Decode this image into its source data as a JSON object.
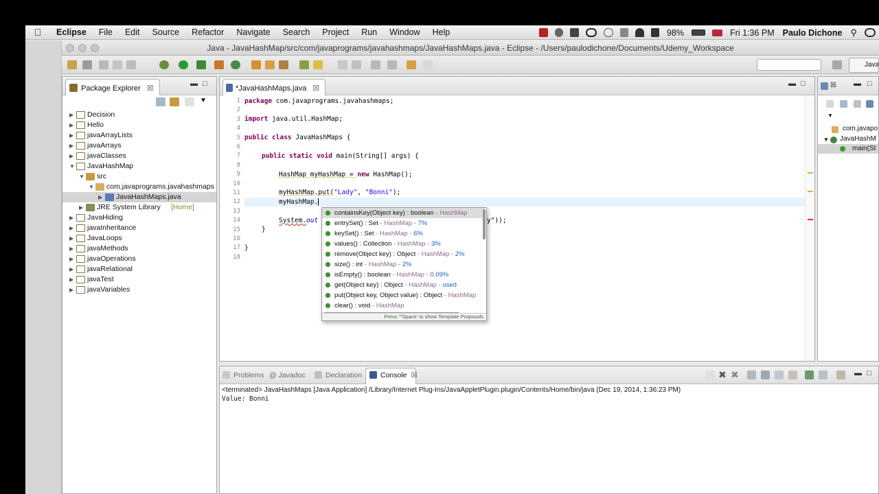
{
  "menubar": {
    "app_name": "Eclipse",
    "items": [
      "File",
      "Edit",
      "Source",
      "Refactor",
      "Navigate",
      "Search",
      "Project",
      "Run",
      "Window",
      "Help"
    ],
    "battery": "98%",
    "clock": "Fri 1:36 PM",
    "user": "Paulo Dichone"
  },
  "window": {
    "title": "Java - JavaHashMap/src/com/javaprograms/javahashmaps/JavaHashMaps.java - Eclipse - /Users/paulodichone/Documents/Udemy_Workspace"
  },
  "toolbar": {
    "perspective_label": "Java"
  },
  "package_explorer": {
    "tab_label": "Package Explorer",
    "close_glyph": "☒",
    "tree": [
      {
        "label": "Decision",
        "level": 0,
        "expanded": false,
        "kind": "project"
      },
      {
        "label": "Hello",
        "level": 0,
        "expanded": false,
        "kind": "project"
      },
      {
        "label": "javaArrayLists",
        "level": 0,
        "expanded": false,
        "kind": "project"
      },
      {
        "label": "javaArrays",
        "level": 0,
        "expanded": false,
        "kind": "project"
      },
      {
        "label": "javaClasses",
        "level": 0,
        "expanded": false,
        "kind": "project"
      },
      {
        "label": "JavaHashMap",
        "level": 0,
        "expanded": true,
        "kind": "project"
      },
      {
        "label": "src",
        "level": 1,
        "expanded": true,
        "kind": "source-folder"
      },
      {
        "label": "com.javaprograms.javahashmaps",
        "level": 2,
        "expanded": true,
        "kind": "package"
      },
      {
        "label": "JavaHashMaps.java",
        "level": 3,
        "expanded": false,
        "kind": "java-file",
        "selected": true
      },
      {
        "label": "JRE System Library",
        "decoration": "[Home]",
        "level": 1,
        "expanded": false,
        "kind": "library"
      },
      {
        "label": "JavaHiding",
        "level": 0,
        "expanded": false,
        "kind": "project"
      },
      {
        "label": "javaInheritance",
        "level": 0,
        "expanded": false,
        "kind": "project"
      },
      {
        "label": "JavaLoops",
        "level": 0,
        "expanded": false,
        "kind": "project"
      },
      {
        "label": "javaMethods",
        "level": 0,
        "expanded": false,
        "kind": "project"
      },
      {
        "label": "javaOperations",
        "level": 0,
        "expanded": false,
        "kind": "project"
      },
      {
        "label": "javaRelational",
        "level": 0,
        "expanded": false,
        "kind": "project"
      },
      {
        "label": "javaTest",
        "level": 0,
        "expanded": false,
        "kind": "project"
      },
      {
        "label": "javaVariables",
        "level": 0,
        "expanded": false,
        "kind": "project"
      }
    ]
  },
  "editor": {
    "tab_label": "*JavaHashMaps.java",
    "close_glyph": "☒",
    "line_numbers": [
      "1",
      "2",
      "3",
      "4",
      "5",
      "6",
      "7",
      "8",
      "9",
      "10",
      "11",
      "12",
      "13",
      "14",
      "15",
      "16",
      "17",
      "18"
    ],
    "lines": {
      "l1a": "package",
      "l1b": " com.javaprograms.javahashmaps;",
      "l3a": "import",
      "l3b": " java.util.HashMap;",
      "l5a": "public class",
      "l5b": " JavaHashMaps {",
      "l7a": "public static void",
      "l7b": " main(String[] args) {",
      "l9a": "HashMap myHashMap = ",
      "l9b": "new",
      "l9c": " HashMap();",
      "l11a": "myHashMap.put(",
      "l11b": "\"Lady\"",
      "l11c": ", ",
      "l11d": "\"Bonni\"",
      "l11e": ");",
      "l12": "myHashMap.",
      "l14a": "System.",
      "l14b": "out",
      "l14c": "y\"));",
      "l15": "}",
      "l17": "}"
    }
  },
  "content_assist": {
    "proposals": [
      {
        "sig": "containsKey(Object key) : boolean",
        "meta": " - HashMap",
        "rel": ""
      },
      {
        "sig": "entrySet() : Set",
        "meta": " - HashMap - ",
        "rel": "7%"
      },
      {
        "sig": "keySet() : Set",
        "meta": " - HashMap - ",
        "rel": "6%"
      },
      {
        "sig": "values() : Collection",
        "meta": " - HashMap - ",
        "rel": "3%"
      },
      {
        "sig": "remove(Object key) : Object",
        "meta": " - HashMap - ",
        "rel": "2%"
      },
      {
        "sig": "size() : int",
        "meta": " - HashMap - ",
        "rel": "2%"
      },
      {
        "sig": "isEmpty() : boolean",
        "meta": " - HashMap - ",
        "rel": "0.09%"
      },
      {
        "sig": "get(Object key) : Object",
        "meta": " - HashMap - ",
        "rel": "used"
      },
      {
        "sig": "put(Object key, Object value) : Object",
        "meta": " - HashMap",
        "rel": ""
      },
      {
        "sig": "clear() : void",
        "meta": " - HashMap",
        "rel": ""
      },
      {
        "sig": "clone() : Object",
        "meta": " - HashMap",
        "rel": ""
      }
    ],
    "status": "Press '^Space' to show Template Proposals"
  },
  "outline": {
    "tab_glyph": "☒",
    "items": [
      "com.javapo",
      "JavaHashM",
      "main(St"
    ]
  },
  "console": {
    "tabs": [
      "Problems",
      "@ Javadoc",
      "Declaration",
      "Console"
    ],
    "close_glyph": "☒",
    "terminated": "<terminated> JavaHashMaps [Java Application] /Library/Internet Plug-Ins/JavaAppletPlugin.plugin/Contents/Home/bin/java (Dec 19, 2014, 1:36:23 PM)",
    "output": "Value: Bonni"
  },
  "colors": {
    "keyword": "#7f0055",
    "string": "#2a00ff",
    "method_icon": "#3a9c2c",
    "selection": "#d4d4d4"
  }
}
